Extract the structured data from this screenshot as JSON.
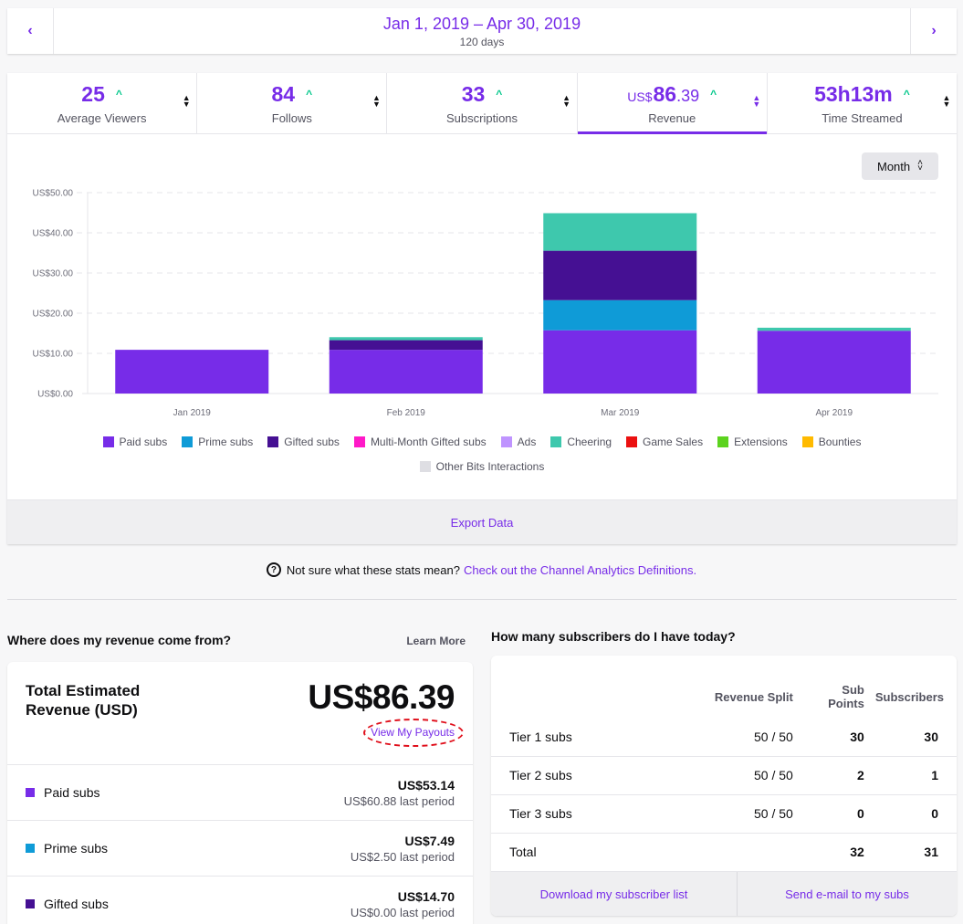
{
  "date_range": {
    "title": "Jan 1, 2019 – Apr 30, 2019",
    "subtitle": "120 days",
    "prev_icon": "chevron-left-icon",
    "next_icon": "chevron-right-icon",
    "prev_glyph": "‹",
    "next_glyph": "›"
  },
  "stat_tabs": [
    {
      "value": "25",
      "label": "Average Viewers",
      "trend": "up",
      "active": false
    },
    {
      "value": "84",
      "label": "Follows",
      "trend": "up",
      "active": false
    },
    {
      "value": "33",
      "label": "Subscriptions",
      "trend": "up",
      "active": false
    },
    {
      "currency": "US$",
      "value": "86",
      "decimal": ".39",
      "label": "Revenue",
      "trend": "up",
      "active": true
    },
    {
      "value": "53h13m",
      "label": "Time Streamed",
      "trend": "up",
      "active": false
    }
  ],
  "trend_glyph": "^",
  "interval_select": {
    "label": "Month"
  },
  "chart_data": {
    "type": "bar",
    "stacked": true,
    "title": "",
    "xlabel": "",
    "ylabel": "",
    "ylim": [
      0,
      50
    ],
    "yticks": [
      "US$0.00",
      "US$10.00",
      "US$20.00",
      "US$30.00",
      "US$40.00",
      "US$50.00"
    ],
    "ytick_values": [
      0,
      10,
      20,
      30,
      40,
      50
    ],
    "grid": true,
    "legend_position": "bottom",
    "categories": [
      "Jan 2019",
      "Feb 2019",
      "Mar 2019",
      "Apr 2019"
    ],
    "series": [
      {
        "name": "Paid subs",
        "color": "#772ce8",
        "values": [
          10.88,
          10.88,
          15.75,
          15.63
        ]
      },
      {
        "name": "Prime subs",
        "color": "#0f9bd7",
        "values": [
          0,
          0,
          7.49,
          0
        ]
      },
      {
        "name": "Gifted subs",
        "color": "#451093",
        "values": [
          0,
          2.4,
          12.3,
          0
        ]
      },
      {
        "name": "Multi-Month Gifted subs",
        "color": "#ff19c8",
        "values": [
          0,
          0,
          0,
          0
        ]
      },
      {
        "name": "Ads",
        "color": "#bf94ff",
        "values": [
          0,
          0,
          0,
          0
        ]
      },
      {
        "name": "Cheering",
        "color": "#3ec8ad",
        "values": [
          0,
          0.75,
          9.35,
          0.75
        ]
      },
      {
        "name": "Game Sales",
        "color": "#eb1010",
        "values": [
          0,
          0,
          0,
          0
        ]
      },
      {
        "name": "Extensions",
        "color": "#5cd31e",
        "values": [
          0,
          0,
          0,
          0
        ]
      },
      {
        "name": "Bounties",
        "color": "#ffba00",
        "values": [
          0,
          0,
          0,
          0
        ]
      },
      {
        "name": "Other Bits Interactions",
        "color": "#dedee3",
        "values": [
          0,
          0,
          0,
          0
        ]
      }
    ]
  },
  "export_label": "Export Data",
  "help": {
    "icon": "question-circle-icon",
    "text": "Not sure what these stats mean?",
    "link": "Check out the Channel Analytics Definitions."
  },
  "revenue_source": {
    "question": "Where does my revenue come from?",
    "learn_more": "Learn More",
    "title": "Total Estimated Revenue (USD)",
    "total": "US$86.39",
    "payouts_link": "View My Payouts",
    "rows": [
      {
        "label": "Paid subs",
        "color": "#772ce8",
        "amount": "US$53.14",
        "last": "US$60.88 last period"
      },
      {
        "label": "Prime subs",
        "color": "#0f9bd7",
        "amount": "US$7.49",
        "last": "US$2.50 last period"
      },
      {
        "label": "Gifted subs",
        "color": "#451093",
        "amount": "US$14.70",
        "last": "US$0.00 last period"
      }
    ]
  },
  "subscribers": {
    "question": "How many subscribers do I have today?",
    "columns": [
      "",
      "Revenue Split",
      "Sub Points",
      "Subscribers"
    ],
    "rows": [
      {
        "name": "Tier 1 subs",
        "split": "50 / 50",
        "points": "30",
        "subs": "30"
      },
      {
        "name": "Tier 2 subs",
        "split": "50 / 50",
        "points": "2",
        "subs": "1"
      },
      {
        "name": "Tier 3 subs",
        "split": "50 / 50",
        "points": "0",
        "subs": "0"
      },
      {
        "name": "Total",
        "split": "",
        "points": "32",
        "subs": "31"
      }
    ],
    "download_label": "Download my subscriber list",
    "email_label": "Send e-mail to my subs"
  },
  "colors": {
    "accent": "#772ce8",
    "trend_up": "#00c78a",
    "annotation": "#e0101c"
  }
}
